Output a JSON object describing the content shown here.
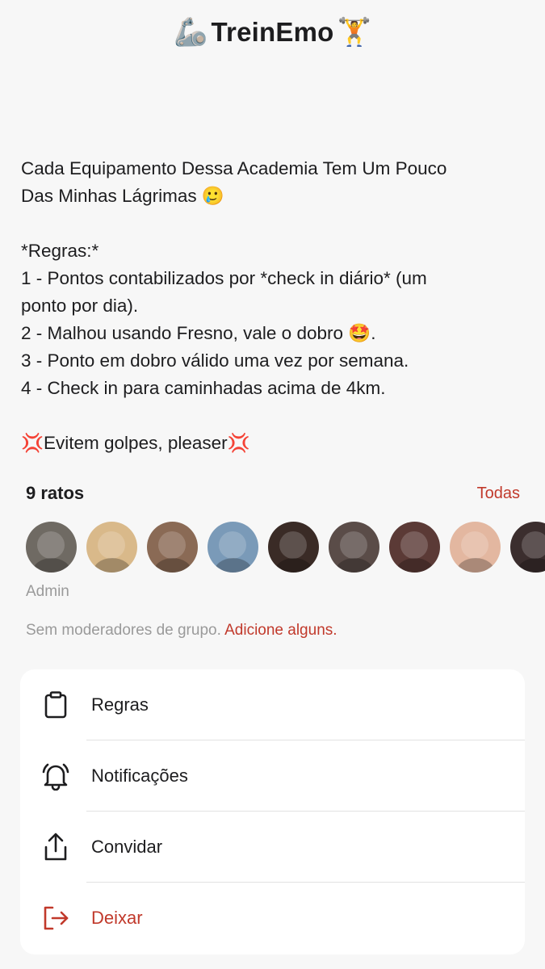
{
  "header": {
    "emoji_left": "🦾",
    "title": "TreinEmo",
    "emoji_right": "🏋️"
  },
  "description": {
    "lines": [
      "Cada Equipamento Dessa Academia Tem Um Pouco",
      "Das Minhas Lágrimas 🥲",
      "",
      "*Regras:*",
      "1 - Pontos contabilizados por *check in diário* (um",
      "ponto por dia).",
      "2 - Malhou usando Fresno, vale o dobro 🤩.",
      "3 - Ponto em dobro válido uma vez por semana.",
      "4 - Check in para caminhadas acima de 4km.",
      "",
      "💢Evitem golpes, pleaser💢"
    ]
  },
  "members": {
    "count_label": "9 ratos",
    "see_all": "Todas",
    "admin_label": "Admin",
    "avatar_colors": [
      "#6f6a63",
      "#d9b98a",
      "#8a6a55",
      "#7a9ab8",
      "#3a2b26",
      "#5a4c48",
      "#5b3a36",
      "#e3b7a0",
      "#3b2e2e"
    ]
  },
  "moderators": {
    "text": "Sem moderadores de grupo.",
    "link": "Adicione alguns."
  },
  "menu": {
    "items": [
      {
        "label": "Regras",
        "icon": "clipboard-icon"
      },
      {
        "label": "Notificações",
        "icon": "bell-ringing-icon"
      },
      {
        "label": "Convidar",
        "icon": "share-icon"
      },
      {
        "label": "Deixar",
        "icon": "logout-icon"
      }
    ]
  },
  "colors": {
    "accent": "#c1392b",
    "background": "#f7f7f7",
    "muted_text": "#9a9a9a"
  }
}
